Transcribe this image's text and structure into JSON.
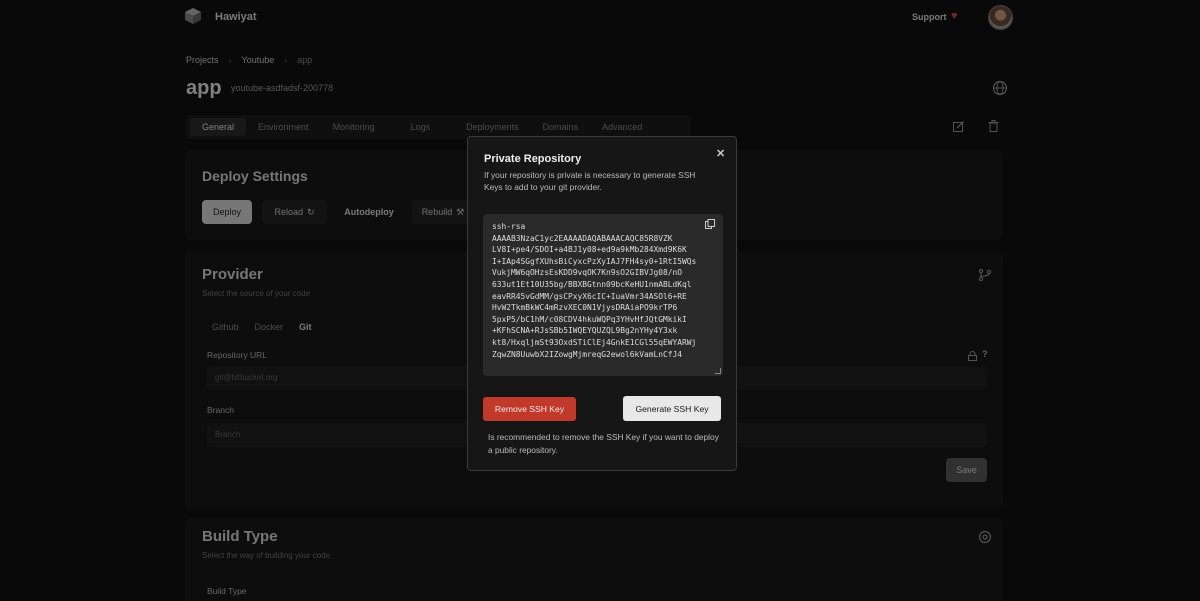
{
  "app": {
    "brand": "Hawiyat",
    "support_label": "Support"
  },
  "breadcrumb": [
    "Projects",
    "Youtube",
    "app"
  ],
  "header": {
    "title": "app",
    "app_id": "youtube-asdfadsf-200778"
  },
  "tabs": [
    "General",
    "Environment",
    "Monitoring",
    "Logs",
    "Deployments",
    "Domains",
    "Advanced"
  ],
  "deploy_settings": {
    "title": "Deploy Settings",
    "buttons": {
      "deploy": "Deploy",
      "reload": "Reload",
      "autodeploy": "Autodeploy",
      "rebuild": "Rebuild"
    }
  },
  "provider": {
    "title": "Provider",
    "subtitle": "Select the source of your code",
    "sources": [
      "Github",
      "Docker",
      "Git"
    ],
    "repository_url_label": "Repository URL",
    "repository_url_placeholder": "git@bitbucket.org",
    "branch_label": "Branch",
    "branch_placeholder": "Branch",
    "save_label": "Save"
  },
  "build_type": {
    "title": "Build Type",
    "subtitle": "Select the way of building your code",
    "label": "Build Type"
  },
  "modal": {
    "title": "Private Repository",
    "description": "If your repository is private is necessary to generate SSH Keys to add to your git provider.",
    "ssh_key": "ssh-rsa\nAAAAB3NzaC1yc2EAAAADAQABAAACAQC85R8VZK\nLV8I+pe4/SDOI+a4BJ1y08+ed9a9kMb284Xmd9K6K\nI+IAp4SGgfXUhsBiCyxcPzXyIAJ7FH4sy0+1RtI5WQs\nVukjMW6qOHzsEsKDD9vqOK7Kn9sO2GIBVJg08/nO\n633ut1Et10U35bg/BBXBGtnn09bcKeHU1nmABLdKql\neavRR45vGdMM/gsCPxyX6cIC+IuaVmr34ASOl6+RE\nHvW2TkmBkWC4mRzvXEC0N1VjysDRAiaPO9krTP6\n5pxP5/bC1hM/c08CDV4hkuWQPq3YHvHfJQtGMkikI\n+KFhSCNA+RJsSBb5IWQEYQUZQL9Bg2nYHy4Y3xk\nkt8/HxqljmSt93OxdSTiClEj4GnkE1CGl55qEWYARWj\nZqwZN8UuwbX2IZowgMjmreqG2ewol6kVamLnCfJ4",
    "remove_label": "Remove SSH Key",
    "generate_label": "Generate SSH Key",
    "note": "Is recommended to remove the SSH Key if you want to deploy a public repository."
  },
  "colors": {
    "danger": "#c0392b",
    "accent_heart": "#e0484b"
  }
}
